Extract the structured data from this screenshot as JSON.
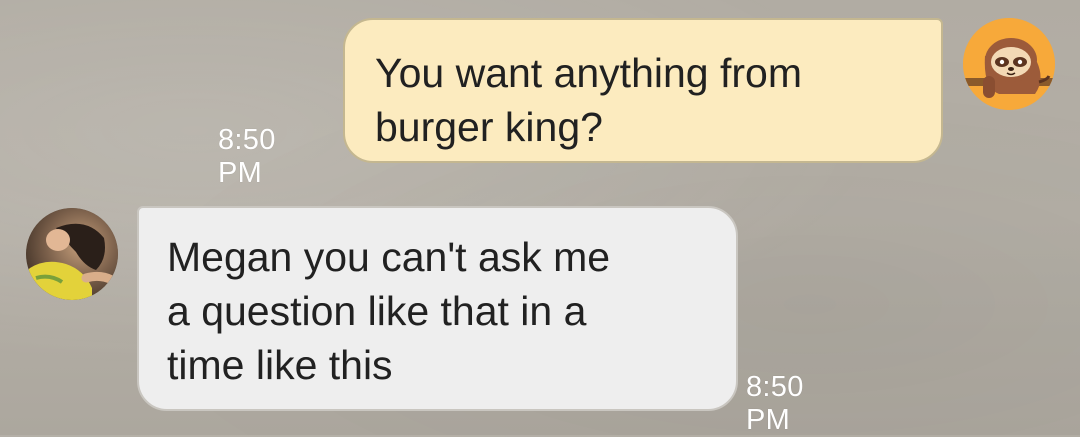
{
  "messages": [
    {
      "direction": "outgoing",
      "text": "You want anything from\nburger king?",
      "time": "8:50 PM",
      "avatar": "sloth-avatar-icon"
    },
    {
      "direction": "incoming",
      "text": "Megan you can't ask me\na question like that in a\ntime like this",
      "time": "8:50 PM",
      "avatar": "contact-photo"
    }
  ],
  "colors": {
    "outgoing_bubble": "#fcebbf",
    "incoming_bubble": "#eeeeee",
    "background": "#b3aea5",
    "timestamp": "#ffffff",
    "sloth_avatar_bg": "#f7a93a"
  }
}
